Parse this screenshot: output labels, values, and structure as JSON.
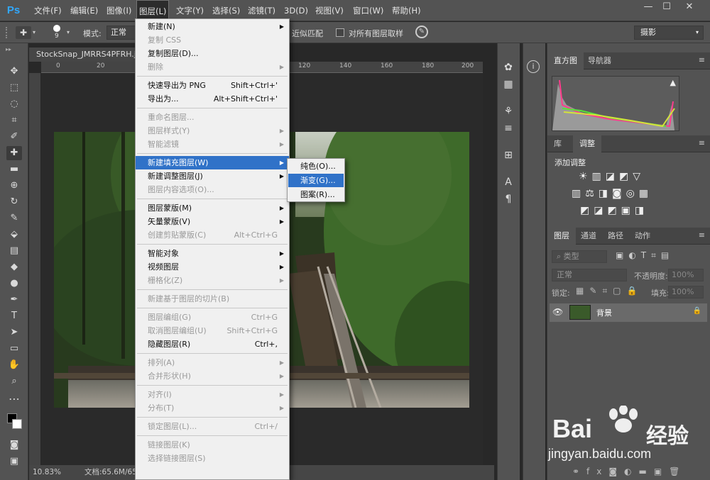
{
  "app": {
    "logo": "Ps"
  },
  "menubar": [
    "文件(F)",
    "编辑(E)",
    "图像(I)",
    "图层(L)",
    "文字(Y)",
    "选择(S)",
    "滤镜(T)",
    "3D(D)",
    "视图(V)",
    "窗口(W)",
    "帮助(H)"
  ],
  "window": {
    "minimize": "—",
    "restore": "☐",
    "close": "✕"
  },
  "options": {
    "brush_size": "9",
    "mode_label": "模式:",
    "mode_value": "正常",
    "match_label": "近似匹配",
    "sample_label": "对所有图层取样",
    "workspace": "摄影"
  },
  "document": {
    "tab": "StockSnap_JMRRS4PFRH.jpg",
    "zoom": "10.83%",
    "doc_info": "文档:65.6M/65",
    "ruler_numbers": [
      "0",
      "20",
      "120",
      "140",
      "160",
      "180",
      "200"
    ]
  },
  "layer_menu": {
    "items": [
      {
        "label": "新建(N)",
        "shortcut": "",
        "submenu": true,
        "disabled": false
      },
      {
        "label": "复制 CSS",
        "shortcut": "",
        "submenu": false,
        "disabled": true
      },
      {
        "label": "复制图层(D)...",
        "shortcut": "",
        "submenu": false,
        "disabled": false
      },
      {
        "label": "删除",
        "shortcut": "",
        "submenu": true,
        "disabled": true
      },
      {
        "sep": true
      },
      {
        "label": "快速导出为 PNG",
        "shortcut": "Shift+Ctrl+'",
        "submenu": false,
        "disabled": false
      },
      {
        "label": "导出为...",
        "shortcut": "Alt+Shift+Ctrl+'",
        "submenu": false,
        "disabled": false
      },
      {
        "sep": true
      },
      {
        "label": "重命名图层...",
        "shortcut": "",
        "submenu": false,
        "disabled": true
      },
      {
        "label": "图层样式(Y)",
        "shortcut": "",
        "submenu": true,
        "disabled": true
      },
      {
        "label": "智能滤镜",
        "shortcut": "",
        "submenu": true,
        "disabled": true
      },
      {
        "sep": true
      },
      {
        "label": "新建填充图层(W)",
        "shortcut": "",
        "submenu": true,
        "disabled": false,
        "highlight": true
      },
      {
        "label": "新建调整图层(J)",
        "shortcut": "",
        "submenu": true,
        "disabled": false
      },
      {
        "label": "图层内容选项(O)...",
        "shortcut": "",
        "submenu": false,
        "disabled": true
      },
      {
        "sep": true
      },
      {
        "label": "图层蒙版(M)",
        "shortcut": "",
        "submenu": true,
        "disabled": false
      },
      {
        "label": "矢量蒙版(V)",
        "shortcut": "",
        "submenu": true,
        "disabled": false
      },
      {
        "label": "创建剪贴蒙版(C)",
        "shortcut": "Alt+Ctrl+G",
        "submenu": false,
        "disabled": true
      },
      {
        "sep": true
      },
      {
        "label": "智能对象",
        "shortcut": "",
        "submenu": true,
        "disabled": false
      },
      {
        "label": "视频图层",
        "shortcut": "",
        "submenu": true,
        "disabled": false
      },
      {
        "label": "栅格化(Z)",
        "shortcut": "",
        "submenu": true,
        "disabled": true
      },
      {
        "sep": true
      },
      {
        "label": "新建基于图层的切片(B)",
        "shortcut": "",
        "submenu": false,
        "disabled": true
      },
      {
        "sep": true
      },
      {
        "label": "图层编组(G)",
        "shortcut": "Ctrl+G",
        "submenu": false,
        "disabled": true
      },
      {
        "label": "取消图层编组(U)",
        "shortcut": "Shift+Ctrl+G",
        "submenu": false,
        "disabled": true
      },
      {
        "label": "隐藏图层(R)",
        "shortcut": "Ctrl+,",
        "submenu": false,
        "disabled": false
      },
      {
        "sep": true
      },
      {
        "label": "排列(A)",
        "shortcut": "",
        "submenu": true,
        "disabled": true
      },
      {
        "label": "合并形状(H)",
        "shortcut": "",
        "submenu": true,
        "disabled": true
      },
      {
        "sep": true
      },
      {
        "label": "对齐(I)",
        "shortcut": "",
        "submenu": true,
        "disabled": true
      },
      {
        "label": "分布(T)",
        "shortcut": "",
        "submenu": true,
        "disabled": true
      },
      {
        "sep": true
      },
      {
        "label": "锁定图层(L)...",
        "shortcut": "Ctrl+/",
        "submenu": false,
        "disabled": true
      },
      {
        "sep": true
      },
      {
        "label": "链接图层(K)",
        "shortcut": "",
        "submenu": false,
        "disabled": true
      },
      {
        "label": "选择链接图层(S)",
        "shortcut": "",
        "submenu": false,
        "disabled": true
      }
    ]
  },
  "fill_submenu": [
    "纯色(O)...",
    "渐变(G)...",
    "图案(R)..."
  ],
  "panels": {
    "histogram_tabs": [
      "直方图",
      "导航器"
    ],
    "adjust_tabs": [
      "库",
      "调整"
    ],
    "adjust_title": "添加调整",
    "layer_tabs": [
      "图层",
      "通道",
      "路径",
      "动作"
    ],
    "filter_kind": "类型",
    "blend_mode": "正常",
    "opacity_label": "不透明度:",
    "opacity_value": "100%",
    "lock_label": "锁定:",
    "fill_label": "填充:",
    "fill_value": "100%",
    "layer_name": "背景"
  },
  "watermark": {
    "brand": "Bai",
    "brand2": "经验",
    "url": "jingyan.baidu.com"
  },
  "colors": {
    "menu_highlight": "#3072c8",
    "ps_blue": "#31a8ff",
    "panel_bg": "#535353"
  }
}
